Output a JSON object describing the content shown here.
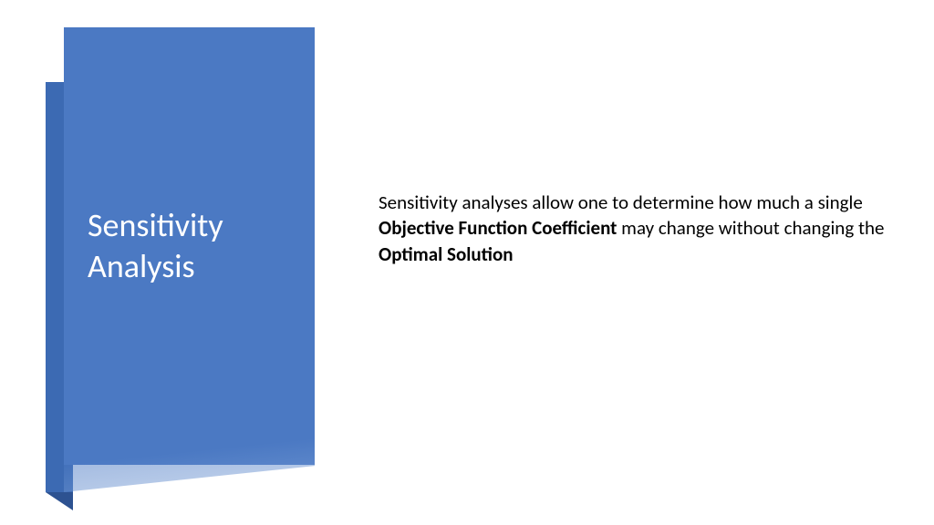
{
  "sidePanel": {
    "title": "Sensitivity Analysis"
  },
  "body": {
    "textPart1": "Sensitivity analyses allow one to determine how much a single ",
    "boldPart1": "Objective Function Coefficient",
    "textPart2": " may change without changing the ",
    "boldPart2": "Optimal Solution"
  }
}
